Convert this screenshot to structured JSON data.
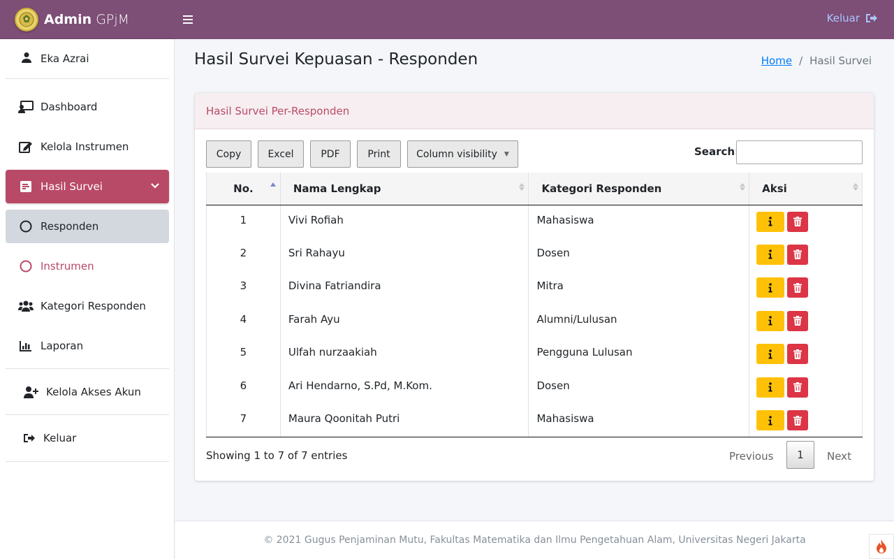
{
  "header": {
    "brand_bold": "Admin",
    "brand_light": " GPjM",
    "logout_label": "Keluar",
    "colors": {
      "topbar": "#7d4e76",
      "accent": "#b94a67"
    }
  },
  "sidebar": {
    "user_name": "Eka Azrai",
    "items": [
      {
        "label": "Dashboard",
        "icon": "chalkboard-user-icon"
      },
      {
        "label": "Kelola Instrumen",
        "icon": "edit-icon"
      },
      {
        "label": "Hasil Survei",
        "icon": "poll-icon",
        "state": "active"
      },
      {
        "label": "Responden",
        "icon": "circle-icon",
        "state": "selected"
      },
      {
        "label": "Instrumen",
        "icon": "circle-icon"
      },
      {
        "label": "Kategori Responden",
        "icon": "users-icon"
      },
      {
        "label": "Laporan",
        "icon": "chart-bar-icon"
      },
      {
        "label": "Kelola Akses Akun",
        "icon": "user-plus-icon"
      },
      {
        "label": "Keluar",
        "icon": "sign-out-icon"
      }
    ]
  },
  "page": {
    "title": "Hasil Survei Kepuasan - Responden",
    "breadcrumb": {
      "home": "Home",
      "separator": "/",
      "current": "Hasil Survei"
    }
  },
  "card": {
    "title": "Hasil Survei Per-Responden",
    "buttons": {
      "copy": "Copy",
      "excel": "Excel",
      "pdf": "PDF",
      "print": "Print",
      "colvis": "Column visibility"
    },
    "search_label": "Search:",
    "search_value": "",
    "columns": [
      "No.",
      "Nama Lengkap",
      "Kategori Responden",
      "Aksi"
    ],
    "rows": [
      {
        "no": "1",
        "nama": "Vivi Rofiah",
        "kategori": "Mahasiswa"
      },
      {
        "no": "2",
        "nama": "Sri Rahayu",
        "kategori": "Dosen"
      },
      {
        "no": "3",
        "nama": "Divina Fatriandira",
        "kategori": "Mitra"
      },
      {
        "no": "4",
        "nama": "Farah Ayu",
        "kategori": "Alumni/Lulusan"
      },
      {
        "no": "5",
        "nama": "Ulfah nurzaakiah",
        "kategori": "Pengguna Lulusan"
      },
      {
        "no": "6",
        "nama": "Ari Hendarno, S.Pd, M.Kom.",
        "kategori": "Dosen"
      },
      {
        "no": "7",
        "nama": "Maura Qoonitah Putri",
        "kategori": "Mahasiswa"
      }
    ],
    "showing": "Showing 1 to 7 of 7 entries",
    "pager": {
      "prev": "Previous",
      "page": "1",
      "next": "Next"
    }
  },
  "footer": {
    "text": "© 2021 Gugus Penjaminan Mutu, Fakultas Matematika dan Ilmu Pengetahuan Alam, Universitas Negeri Jakarta"
  }
}
